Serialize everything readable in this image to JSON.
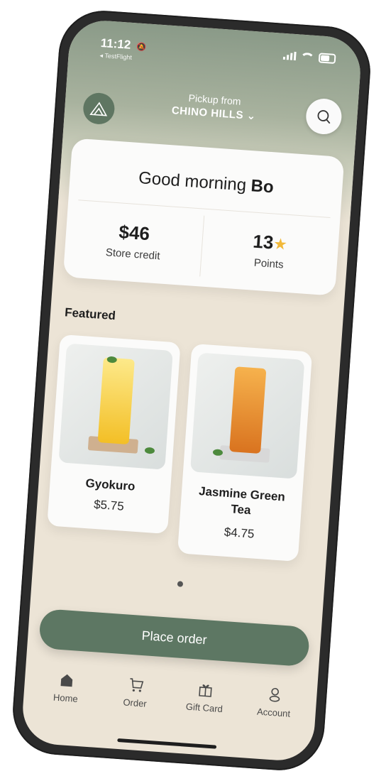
{
  "status": {
    "time": "11:12",
    "back_label": "◂ TestFlight"
  },
  "header": {
    "pickup_label": "Pickup from",
    "store_name": "CHINO HILLS"
  },
  "greeting": {
    "prefix": "Good morning",
    "name": "Bo"
  },
  "stats": {
    "credit_value": "$46",
    "credit_label": "Store credit",
    "points_value": "13",
    "points_label": "Points"
  },
  "featured": {
    "title": "Featured",
    "items": [
      {
        "name": "Gyokuro",
        "price": "$5.75"
      },
      {
        "name": "Jasmine Green Tea",
        "price": "$4.75"
      }
    ]
  },
  "cta": {
    "label": "Place order"
  },
  "tabs": [
    {
      "label": "Home",
      "icon": "home-icon"
    },
    {
      "label": "Order",
      "icon": "cart-icon"
    },
    {
      "label": "Gift Card",
      "icon": "gift-icon"
    },
    {
      "label": "Account",
      "icon": "person-icon"
    }
  ],
  "colors": {
    "accent": "#5d7763",
    "background": "#ece4d6",
    "star": "#f2b93a"
  }
}
